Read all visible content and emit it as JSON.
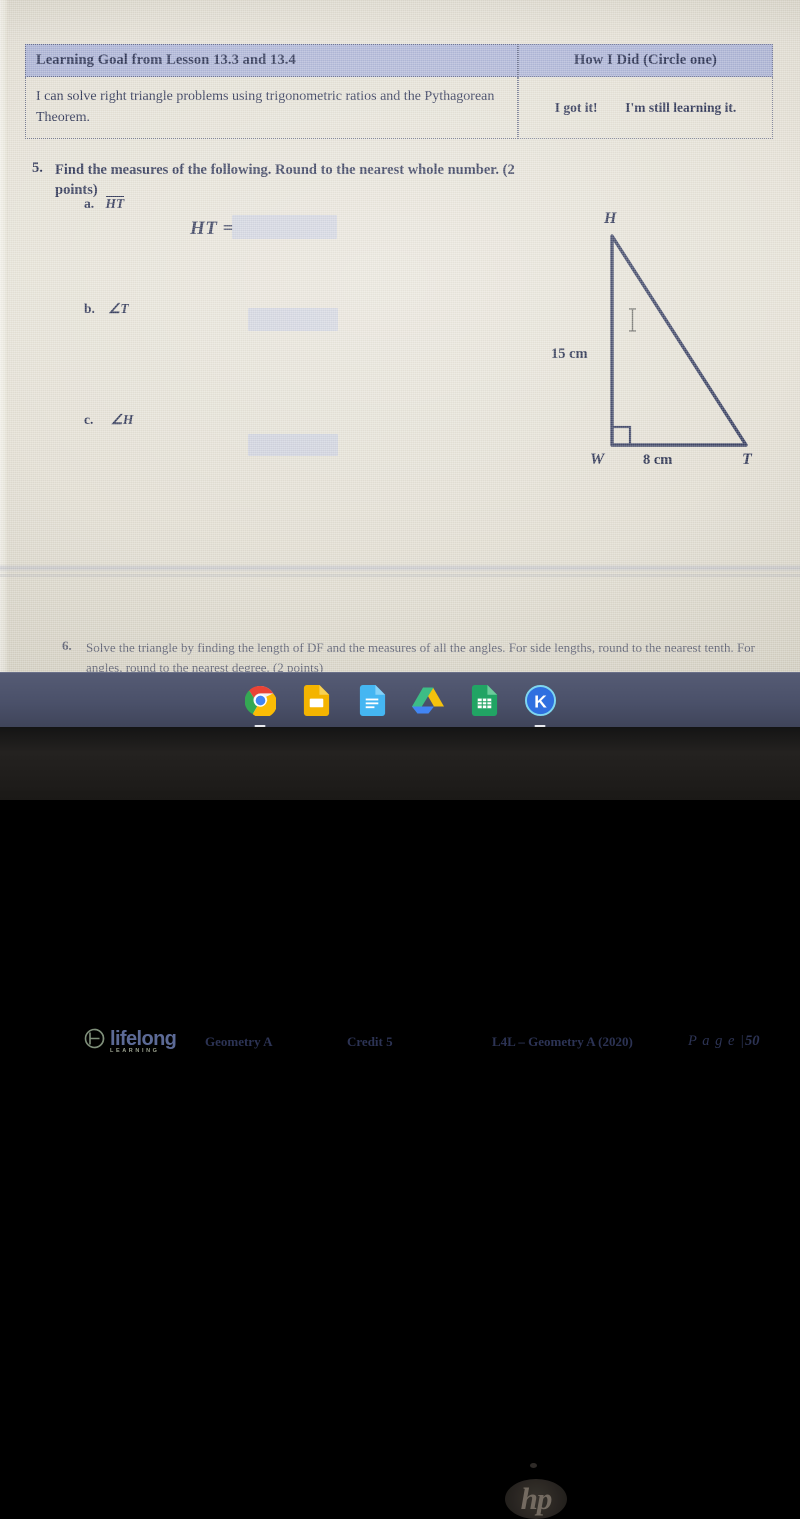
{
  "document": {
    "learning_goal_table": {
      "header_left": "Learning Goal from Lesson 13.3 and 13.4",
      "header_right": "How I Did (Circle one)",
      "goal_text": "I can solve right triangle problems using trigonometric ratios and the Pythagorean Theorem.",
      "choices": [
        "I got it!",
        "I'm still learning it."
      ]
    },
    "question5": {
      "number": "5.",
      "prompt": "Find the measures of the following. Round to the nearest whole number. (2 points)",
      "points": "(2 points)",
      "parts": [
        {
          "letter": "a.",
          "label": "HT",
          "label_kind": "segment",
          "answer_prefix": "HT =",
          "answer_value": ""
        },
        {
          "letter": "b.",
          "label": "∠T",
          "label_kind": "angle",
          "answer_value": ""
        },
        {
          "letter": "c.",
          "label": "∠H",
          "label_kind": "angle",
          "answer_value": ""
        }
      ],
      "figure": {
        "type": "right-triangle",
        "vertices": [
          "H",
          "W",
          "T"
        ],
        "right_angle_at": "W",
        "side_labels": [
          {
            "name": "HW",
            "text": "15 cm",
            "value": 15,
            "unit": "cm"
          },
          {
            "name": "WT",
            "text": "8 cm",
            "value": 8,
            "unit": "cm"
          }
        ]
      }
    },
    "question6": {
      "number": "6.",
      "prompt": "Solve the triangle by finding the length of DF and the measures of all the angles. For side lengths, round to the nearest tenth. For angles, round to the nearest degree. (2 points)",
      "segment": "DF",
      "points": "(2 points)"
    },
    "footer": {
      "logo_text": "lifelong",
      "logo_subtext": "LEARNING",
      "course": "Geometry A",
      "credit": "Credit 5",
      "source": "L4L – Geometry A (2020)",
      "page_label": "P a g e",
      "page_separator": "|",
      "page_number": "50"
    }
  },
  "taskbar": {
    "apps": [
      {
        "name": "chrome-icon",
        "label": "Google Chrome",
        "running": true
      },
      {
        "name": "slides-icon",
        "label": "Google Slides",
        "running": false
      },
      {
        "name": "docs-icon",
        "label": "Google Docs",
        "running": false
      },
      {
        "name": "drive-icon",
        "label": "Google Drive",
        "running": false
      },
      {
        "name": "sheets-icon",
        "label": "Google Sheets",
        "running": false
      },
      {
        "name": "kami-icon",
        "label": "Kami",
        "running": true
      }
    ]
  },
  "device": {
    "brand": "hp"
  },
  "colors": {
    "table_header_fill": "#aeb5d7",
    "ink": "#2c3354",
    "answer_field": "#c8cddf",
    "paper": "#e7e3d8",
    "taskbar": "#4a5069",
    "logo": "#5c6a96"
  }
}
